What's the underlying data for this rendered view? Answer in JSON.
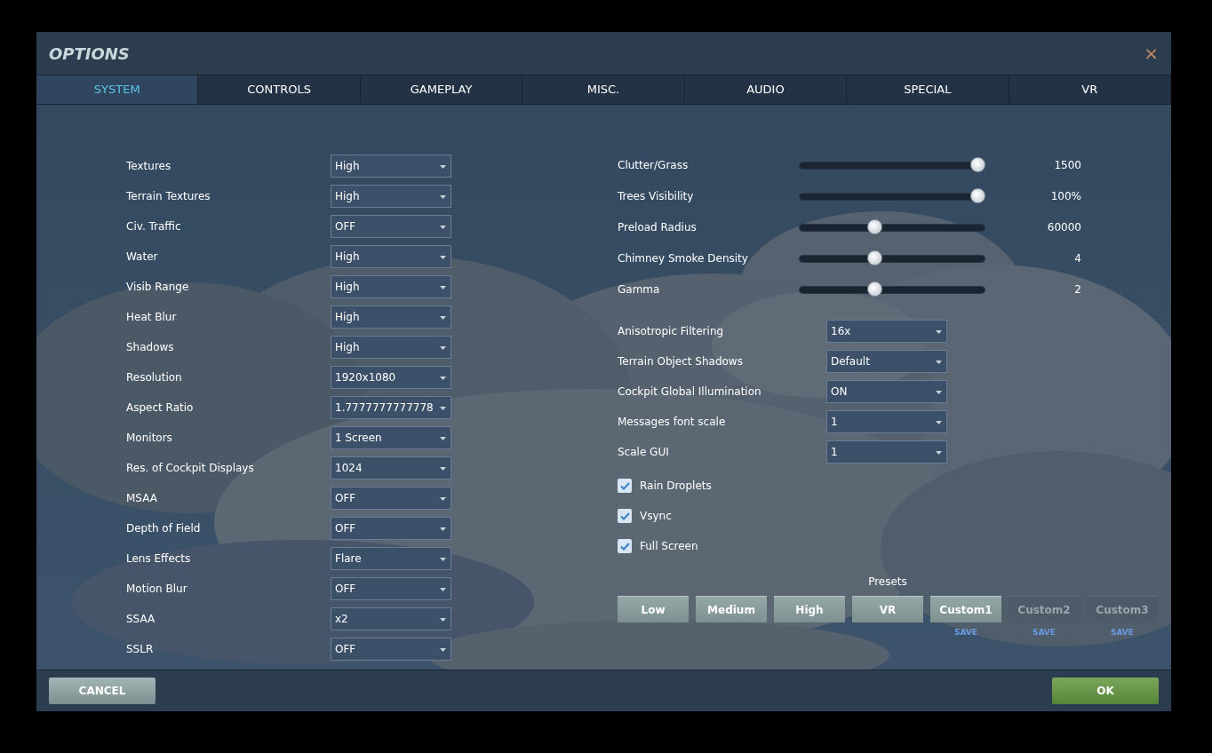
{
  "window": {
    "title": "OPTIONS",
    "close": "×"
  },
  "tabs": [
    {
      "label": "SYSTEM",
      "selected": true
    },
    {
      "label": "CONTROLS",
      "selected": false
    },
    {
      "label": "GAMEPLAY",
      "selected": false
    },
    {
      "label": "MISC.",
      "selected": false
    },
    {
      "label": "AUDIO",
      "selected": false
    },
    {
      "label": "SPECIAL",
      "selected": false
    },
    {
      "label": "VR",
      "selected": false
    }
  ],
  "left_settings": [
    {
      "label": "Textures",
      "value": "High"
    },
    {
      "label": "Terrain Textures",
      "value": "High"
    },
    {
      "label": "Civ. Traffic",
      "value": "OFF"
    },
    {
      "label": "Water",
      "value": "High"
    },
    {
      "label": "Visib Range",
      "value": "High"
    },
    {
      "label": "Heat Blur",
      "value": "High"
    },
    {
      "label": "Shadows",
      "value": "High"
    },
    {
      "label": "Resolution",
      "value": "1920x1080"
    },
    {
      "label": "Aspect Ratio",
      "value": "1.7777777777778"
    },
    {
      "label": "Monitors",
      "value": "1 Screen"
    },
    {
      "label": "Res. of Cockpit Displays",
      "value": "1024"
    },
    {
      "label": "MSAA",
      "value": "OFF"
    },
    {
      "label": "Depth of Field",
      "value": "OFF"
    },
    {
      "label": "Lens Effects",
      "value": "Flare"
    },
    {
      "label": "Motion Blur",
      "value": "OFF"
    },
    {
      "label": "SSAA",
      "value": "x2"
    },
    {
      "label": "SSLR",
      "value": "OFF"
    }
  ],
  "sliders": [
    {
      "label": "Clutter/Grass",
      "level": 1.0,
      "reading": "1500"
    },
    {
      "label": "Trees Visibility",
      "level": 1.0,
      "reading": "100%"
    },
    {
      "label": "Preload Radius",
      "level": 0.4,
      "reading": "60000"
    },
    {
      "label": "Chimney Smoke Density",
      "level": 0.4,
      "reading": "4"
    },
    {
      "label": "Gamma",
      "level": 0.4,
      "reading": "2"
    }
  ],
  "right_settings": [
    {
      "label": "Anisotropic Filtering",
      "value": "16x"
    },
    {
      "label": "Terrain Object Shadows",
      "value": "Default"
    },
    {
      "label": "Cockpit Global Illumination",
      "value": "ON"
    },
    {
      "label": "Messages font scale",
      "value": "1"
    },
    {
      "label": "Scale GUI",
      "value": "1"
    }
  ],
  "checkboxes": [
    {
      "label": "Rain Droplets",
      "checked": true
    },
    {
      "label": "Vsync",
      "checked": true
    },
    {
      "label": "Full Screen",
      "checked": true
    }
  ],
  "presets": {
    "title": "Presets",
    "buttons": [
      {
        "label": "Low",
        "disabled": false
      },
      {
        "label": "Medium",
        "disabled": false
      },
      {
        "label": "High",
        "disabled": false
      },
      {
        "label": "VR",
        "disabled": false
      },
      {
        "label": "Custom1",
        "disabled": false,
        "save": "SAVE"
      },
      {
        "label": "Custom2",
        "disabled": true,
        "save": "SAVE"
      },
      {
        "label": "Custom3",
        "disabled": true,
        "save": "SAVE"
      }
    ]
  },
  "footer": {
    "cancel": "CANCEL",
    "ok": "OK"
  }
}
